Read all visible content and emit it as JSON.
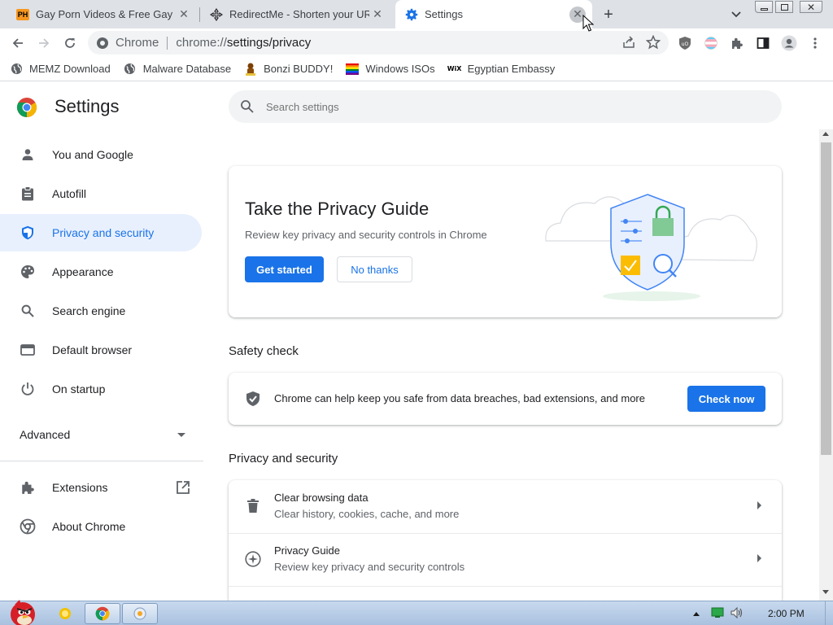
{
  "tabs": [
    {
      "title": "Gay Porn Videos & Free Gay M",
      "icon": "ph-icon"
    },
    {
      "title": "RedirectMe - Shorten your UR",
      "icon": "move-icon"
    },
    {
      "title": "Settings",
      "icon": "gear-icon",
      "active": true
    }
  ],
  "toolbar": {
    "chip_label": "Chrome",
    "url_scheme": "chrome://",
    "url_path": "settings/privacy"
  },
  "bookmarks": [
    {
      "label": "MEMZ Download",
      "icon": "globe-icon"
    },
    {
      "label": "Malware Database",
      "icon": "globe-icon"
    },
    {
      "label": "Bonzi BUDDY!",
      "icon": "bonzi-icon"
    },
    {
      "label": "Windows ISOs",
      "icon": "rainbow-flag-icon"
    },
    {
      "label": "Egyptian Embassy",
      "icon": "wix-icon"
    }
  ],
  "settings": {
    "title": "Settings",
    "search_placeholder": "Search settings",
    "nav": [
      {
        "label": "You and Google",
        "icon": "person-icon"
      },
      {
        "label": "Autofill",
        "icon": "clipboard-icon"
      },
      {
        "label": "Privacy and security",
        "icon": "shield-icon",
        "selected": true
      },
      {
        "label": "Appearance",
        "icon": "palette-icon"
      },
      {
        "label": "Search engine",
        "icon": "search-icon"
      },
      {
        "label": "Default browser",
        "icon": "browser-icon"
      },
      {
        "label": "On startup",
        "icon": "power-icon"
      }
    ],
    "advanced_label": "Advanced",
    "nav_bottom": [
      {
        "label": "Extensions",
        "icon": "puzzle-icon"
      },
      {
        "label": "About Chrome",
        "icon": "chrome-icon"
      }
    ],
    "privacy_guide": {
      "title": "Take the Privacy Guide",
      "description": "Review key privacy and security controls in Chrome",
      "primary_button": "Get started",
      "secondary_button": "No thanks"
    },
    "safety_check": {
      "section_title": "Safety check",
      "text": "Chrome can help keep you safe from data breaches, bad extensions, and more",
      "button": "Check now"
    },
    "privacy_section": {
      "section_title": "Privacy and security",
      "rows": [
        {
          "title": "Clear browsing data",
          "subtitle": "Clear history, cookies, cache, and more",
          "icon": "trash-icon"
        },
        {
          "title": "Privacy Guide",
          "subtitle": "Review key privacy and security controls",
          "icon": "compass-icon"
        }
      ]
    }
  },
  "taskbar": {
    "clock": "2:00 PM"
  },
  "colors": {
    "accent": "#1a73e8",
    "selected_nav_bg": "#e8f0fe",
    "tabstrip_bg": "#dee1e6"
  }
}
